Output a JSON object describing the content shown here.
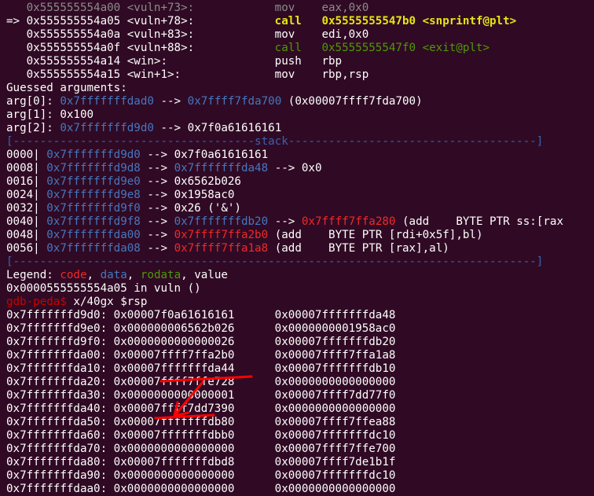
{
  "disasm": [
    {
      "prefix": "   ",
      "addr": "0x555555554a00",
      "sym": "<vuln+73>:",
      "op": "mov",
      "args": "eax,0x0",
      "style": "past"
    },
    {
      "prefix": "=> ",
      "addr": "0x555555554a05",
      "sym": "<vuln+78>:",
      "op": "call",
      "args": "0x5555555547b0 <snprintf@plt>",
      "style": "current"
    },
    {
      "prefix": "   ",
      "addr": "0x555555554a0a",
      "sym": "<vuln+83>:",
      "op": "mov",
      "args": "edi,0x0",
      "style": "next"
    },
    {
      "prefix": "   ",
      "addr": "0x555555554a0f",
      "sym": "<vuln+88>:",
      "op": "call",
      "args": "0x5555555547f0 <exit@plt>",
      "style": "nextcall"
    },
    {
      "prefix": "   ",
      "addr": "0x555555554a14",
      "sym": "<win>:",
      "op": "push",
      "args": "rbp",
      "style": "next"
    },
    {
      "prefix": "   ",
      "addr": "0x555555554a15",
      "sym": "<win+1>:",
      "op": "mov",
      "args": "rbp,rsp",
      "style": "next"
    }
  ],
  "guessed_title": "Guessed arguments:",
  "args": [
    {
      "label": "arg[0]: ",
      "ptr": "0x7fffffffdad0",
      "arrow": " --> ",
      "target": "0x7ffff7fda700",
      "tail": " (0x00007ffff7fda700)"
    },
    {
      "label": "arg[1]: ",
      "value": "0x100"
    },
    {
      "label": "arg[2]: ",
      "ptr": "0x7fffffffd9d0",
      "arrow": " --> ",
      "target": "",
      "tail": "0x7f0a61616161"
    }
  ],
  "stack_sep": "[------------------------------------stack-------------------------------------]",
  "stack": [
    {
      "off": "0000| ",
      "addr": "0x7fffffffd9d0",
      "rest": [
        {
          "t": " --> ",
          "c": "w"
        },
        {
          "t": "0x7f0a61616161",
          "c": "w"
        }
      ]
    },
    {
      "off": "0008| ",
      "addr": "0x7fffffffd9d8",
      "rest": [
        {
          "t": " --> ",
          "c": "w"
        },
        {
          "t": "0x7fffffffda48",
          "c": "b"
        },
        {
          "t": " --> 0x0",
          "c": "w"
        }
      ]
    },
    {
      "off": "0016| ",
      "addr": "0x7fffffffd9e0",
      "rest": [
        {
          "t": " --> ",
          "c": "w"
        },
        {
          "t": "0x6562b026",
          "c": "w"
        }
      ]
    },
    {
      "off": "0024| ",
      "addr": "0x7fffffffd9e8",
      "rest": [
        {
          "t": " --> ",
          "c": "w"
        },
        {
          "t": "0x1958ac0",
          "c": "w"
        }
      ]
    },
    {
      "off": "0032| ",
      "addr": "0x7fffffffd9f0",
      "rest": [
        {
          "t": " --> ",
          "c": "w"
        },
        {
          "t": "0x26 ('&')",
          "c": "w"
        }
      ]
    },
    {
      "off": "0040| ",
      "addr": "0x7fffffffd9f8",
      "rest": [
        {
          "t": " --> ",
          "c": "w"
        },
        {
          "t": "0x7fffffffdb20",
          "c": "b"
        },
        {
          "t": " --> ",
          "c": "w"
        },
        {
          "t": "0x7ffff7ffa280",
          "c": "r"
        },
        {
          "t": " (add    BYTE PTR ss:[rax",
          "c": "w"
        }
      ]
    },
    {
      "off": "0048| ",
      "addr": "0x7fffffffda00",
      "rest": [
        {
          "t": " --> ",
          "c": "w"
        },
        {
          "t": "0x7ffff7ffa2b0",
          "c": "r"
        },
        {
          "t": " (add    BYTE PTR [rdi+0x5f],bl)",
          "c": "w"
        }
      ]
    },
    {
      "off": "0056| ",
      "addr": "0x7fffffffda08",
      "rest": [
        {
          "t": " --> ",
          "c": "w"
        },
        {
          "t": "0x7ffff7ffa1a8",
          "c": "r"
        },
        {
          "t": " (add    BYTE PTR [rax],al)",
          "c": "w"
        }
      ]
    }
  ],
  "bottom_sep": "[------------------------------------------------------------------------------]",
  "legend": {
    "label": "Legend: ",
    "code": "code",
    "data": "data",
    "rodata": "rodata",
    "value": "value",
    "comma": ", "
  },
  "location": "0x0000555555554a05 in vuln ()",
  "prompt": "gdb-peda$",
  "command": " x/40gx $rsp",
  "dump": [
    {
      "a": "0x7fffffffd9d0:",
      "v1": "0x00007f0a61616161",
      "v2": "0x00007fffffffda48"
    },
    {
      "a": "0x7fffffffd9e0:",
      "v1": "0x000000006562b026",
      "v2": "0x0000000001958ac0"
    },
    {
      "a": "0x7fffffffd9f0:",
      "v1": "0x0000000000000026",
      "v2": "0x00007fffffffdb20"
    },
    {
      "a": "0x7fffffffda00:",
      "v1": "0x00007ffff7ffa2b0",
      "v2": "0x00007ffff7ffa1a8"
    },
    {
      "a": "0x7fffffffda10:",
      "v1": "0x00007fffffffda44",
      "v2": "0x00007fffffffdb10"
    },
    {
      "a": "0x7fffffffda20:",
      "v1": "0x00007ffff7ffe728",
      "v2": "0x0000000000000000"
    },
    {
      "a": "0x7fffffffda30:",
      "v1": "0x0000000000000001",
      "v2": "0x00007ffff7dd77f0"
    },
    {
      "a": "0x7fffffffda40:",
      "v1": "0x00007ffff7dd7390",
      "v2": "0x0000000000000000"
    },
    {
      "a": "0x7fffffffda50:",
      "v1": "0x00007fffffffdb80",
      "v2": "0x00007ffff7ffea88"
    },
    {
      "a": "0x7fffffffda60:",
      "v1": "0x00007fffffffdbb0",
      "v2": "0x00007fffffffdc10"
    },
    {
      "a": "0x7fffffffda70:",
      "v1": "0x0000000000000000",
      "v2": "0x00007ffff7ffe700"
    },
    {
      "a": "0x7fffffffda80:",
      "v1": "0x00007fffffffdbd8",
      "v2": "0x00007ffff7de1b1f"
    },
    {
      "a": "0x7fffffffda90:",
      "v1": "0x0000000000000000",
      "v2": "0x00007fffffffdc10"
    },
    {
      "a": "0x7fffffffdaa0:",
      "v1": "0x0000000000000000",
      "v2": "0x0000000000000000"
    }
  ],
  "colors": {
    "background": "#300a24",
    "pointer": "#4677bf",
    "code": "#ef2929",
    "current": "#e5e513",
    "prompt": "#cc0000",
    "annotation": "#ff0000"
  }
}
